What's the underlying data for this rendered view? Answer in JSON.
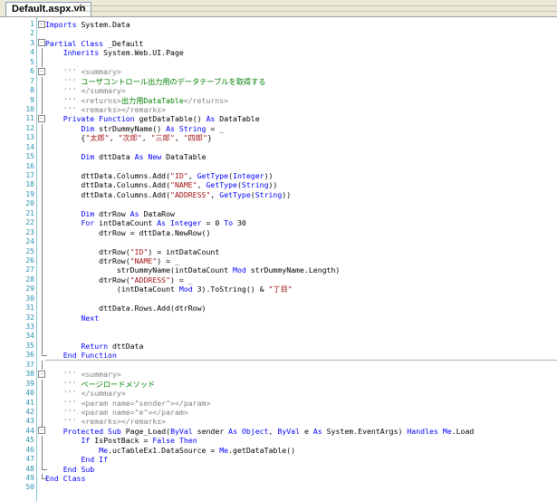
{
  "tab": {
    "title": "Default.aspx.vb"
  },
  "lines": [
    {
      "n": "1",
      "fold": "box-minus",
      "segs": [
        {
          "t": "Imports",
          "c": "k"
        },
        {
          "t": " System.Data",
          "c": ""
        }
      ]
    },
    {
      "n": "2",
      "fold": "",
      "segs": []
    },
    {
      "n": "3",
      "fold": "box-minus",
      "segs": [
        {
          "t": "Partial",
          "c": "k"
        },
        {
          "t": " ",
          "c": ""
        },
        {
          "t": "Class",
          "c": "k"
        },
        {
          "t": " _Default",
          "c": ""
        }
      ]
    },
    {
      "n": "4",
      "fold": "bar",
      "segs": [
        {
          "t": "    ",
          "c": ""
        },
        {
          "t": "Inherits",
          "c": "k"
        },
        {
          "t": " System.Web.UI.Page",
          "c": ""
        }
      ]
    },
    {
      "n": "5",
      "fold": "bar",
      "segs": []
    },
    {
      "n": "6",
      "fold": "box-minus",
      "segs": [
        {
          "t": "    ",
          "c": ""
        },
        {
          "t": "'''",
          "c": "cm"
        },
        {
          "t": " ",
          "c": ""
        },
        {
          "t": "<summary>",
          "c": "cm"
        }
      ]
    },
    {
      "n": "7",
      "fold": "bar",
      "segs": [
        {
          "t": "    ",
          "c": ""
        },
        {
          "t": "'''",
          "c": "cm"
        },
        {
          "t": " ユーザコントロール出力用のデータテーブルを取得する",
          "c": "c"
        }
      ]
    },
    {
      "n": "8",
      "fold": "bar",
      "segs": [
        {
          "t": "    ",
          "c": ""
        },
        {
          "t": "'''",
          "c": "cm"
        },
        {
          "t": " ",
          "c": ""
        },
        {
          "t": "</summary>",
          "c": "cm"
        }
      ]
    },
    {
      "n": "9",
      "fold": "bar",
      "segs": [
        {
          "t": "    ",
          "c": ""
        },
        {
          "t": "'''",
          "c": "cm"
        },
        {
          "t": " ",
          "c": ""
        },
        {
          "t": "<returns>",
          "c": "cm"
        },
        {
          "t": "出力用DataTable",
          "c": "c"
        },
        {
          "t": "</returns>",
          "c": "cm"
        }
      ]
    },
    {
      "n": "10",
      "fold": "bar",
      "segs": [
        {
          "t": "    ",
          "c": ""
        },
        {
          "t": "'''",
          "c": "cm"
        },
        {
          "t": " ",
          "c": ""
        },
        {
          "t": "<remarks></remarks>",
          "c": "cm"
        }
      ]
    },
    {
      "n": "11",
      "fold": "box-minus",
      "segs": [
        {
          "t": "    ",
          "c": ""
        },
        {
          "t": "Private",
          "c": "k"
        },
        {
          "t": " ",
          "c": ""
        },
        {
          "t": "Function",
          "c": "k"
        },
        {
          "t": " getDataTable() ",
          "c": ""
        },
        {
          "t": "As",
          "c": "k"
        },
        {
          "t": " DataTable",
          "c": ""
        }
      ]
    },
    {
      "n": "12",
      "fold": "bar",
      "segs": [
        {
          "t": "        ",
          "c": ""
        },
        {
          "t": "Dim",
          "c": "k"
        },
        {
          "t": " strDummyName() ",
          "c": ""
        },
        {
          "t": "As",
          "c": "k"
        },
        {
          "t": " ",
          "c": ""
        },
        {
          "t": "String",
          "c": "k"
        },
        {
          "t": " = _",
          "c": ""
        }
      ]
    },
    {
      "n": "13",
      "fold": "bar",
      "segs": [
        {
          "t": "        {",
          "c": ""
        },
        {
          "t": "\"太郎\"",
          "c": "s"
        },
        {
          "t": ", ",
          "c": ""
        },
        {
          "t": "\"次郎\"",
          "c": "s"
        },
        {
          "t": ", ",
          "c": ""
        },
        {
          "t": "\"三郎\"",
          "c": "s"
        },
        {
          "t": ", ",
          "c": ""
        },
        {
          "t": "\"四郎\"",
          "c": "s"
        },
        {
          "t": "}",
          "c": ""
        }
      ]
    },
    {
      "n": "14",
      "fold": "bar",
      "segs": []
    },
    {
      "n": "15",
      "fold": "bar",
      "segs": [
        {
          "t": "        ",
          "c": ""
        },
        {
          "t": "Dim",
          "c": "k"
        },
        {
          "t": " dttData ",
          "c": ""
        },
        {
          "t": "As",
          "c": "k"
        },
        {
          "t": " ",
          "c": ""
        },
        {
          "t": "New",
          "c": "k"
        },
        {
          "t": " DataTable",
          "c": ""
        }
      ]
    },
    {
      "n": "16",
      "fold": "bar",
      "segs": []
    },
    {
      "n": "17",
      "fold": "bar",
      "segs": [
        {
          "t": "        dttData.Columns.Add(",
          "c": ""
        },
        {
          "t": "\"ID\"",
          "c": "s"
        },
        {
          "t": ", ",
          "c": ""
        },
        {
          "t": "GetType",
          "c": "k"
        },
        {
          "t": "(",
          "c": ""
        },
        {
          "t": "Integer",
          "c": "k"
        },
        {
          "t": "))",
          "c": ""
        }
      ]
    },
    {
      "n": "18",
      "fold": "bar",
      "segs": [
        {
          "t": "        dttData.Columns.Add(",
          "c": ""
        },
        {
          "t": "\"NAME\"",
          "c": "s"
        },
        {
          "t": ", ",
          "c": ""
        },
        {
          "t": "GetType",
          "c": "k"
        },
        {
          "t": "(",
          "c": ""
        },
        {
          "t": "String",
          "c": "k"
        },
        {
          "t": "))",
          "c": ""
        }
      ]
    },
    {
      "n": "19",
      "fold": "bar",
      "segs": [
        {
          "t": "        dttData.Columns.Add(",
          "c": ""
        },
        {
          "t": "\"ADDRESS\"",
          "c": "s"
        },
        {
          "t": ", ",
          "c": ""
        },
        {
          "t": "GetType",
          "c": "k"
        },
        {
          "t": "(",
          "c": ""
        },
        {
          "t": "String",
          "c": "k"
        },
        {
          "t": "))",
          "c": ""
        }
      ]
    },
    {
      "n": "20",
      "fold": "bar",
      "segs": []
    },
    {
      "n": "21",
      "fold": "bar",
      "segs": [
        {
          "t": "        ",
          "c": ""
        },
        {
          "t": "Dim",
          "c": "k"
        },
        {
          "t": " dtrRow ",
          "c": ""
        },
        {
          "t": "As",
          "c": "k"
        },
        {
          "t": " DataRow",
          "c": ""
        }
      ]
    },
    {
      "n": "22",
      "fold": "bar",
      "segs": [
        {
          "t": "        ",
          "c": ""
        },
        {
          "t": "For",
          "c": "k"
        },
        {
          "t": " intDataCount ",
          "c": ""
        },
        {
          "t": "As",
          "c": "k"
        },
        {
          "t": " ",
          "c": ""
        },
        {
          "t": "Integer",
          "c": "k"
        },
        {
          "t": " = 0 ",
          "c": ""
        },
        {
          "t": "To",
          "c": "k"
        },
        {
          "t": " 30",
          "c": ""
        }
      ]
    },
    {
      "n": "23",
      "fold": "bar",
      "segs": [
        {
          "t": "            dtrRow = dttData.NewRow()",
          "c": ""
        }
      ]
    },
    {
      "n": "24",
      "fold": "bar",
      "segs": []
    },
    {
      "n": "25",
      "fold": "bar",
      "segs": [
        {
          "t": "            dtrRow(",
          "c": ""
        },
        {
          "t": "\"ID\"",
          "c": "s"
        },
        {
          "t": ") = intDataCount",
          "c": ""
        }
      ]
    },
    {
      "n": "26",
      "fold": "bar",
      "segs": [
        {
          "t": "            dtrRow(",
          "c": ""
        },
        {
          "t": "\"NAME\"",
          "c": "s"
        },
        {
          "t": ") = _",
          "c": ""
        }
      ]
    },
    {
      "n": "27",
      "fold": "bar",
      "segs": [
        {
          "t": "                strDummyName(intDataCount ",
          "c": ""
        },
        {
          "t": "Mod",
          "c": "k"
        },
        {
          "t": " strDummyName.Length)",
          "c": ""
        }
      ]
    },
    {
      "n": "28",
      "fold": "bar",
      "segs": [
        {
          "t": "            dtrRow(",
          "c": ""
        },
        {
          "t": "\"ADDRESS\"",
          "c": "s"
        },
        {
          "t": ") = _",
          "c": ""
        }
      ]
    },
    {
      "n": "29",
      "fold": "bar",
      "segs": [
        {
          "t": "                (intDataCount ",
          "c": ""
        },
        {
          "t": "Mod",
          "c": "k"
        },
        {
          "t": " 3).ToString() & ",
          "c": ""
        },
        {
          "t": "\"丁目\"",
          "c": "s"
        }
      ]
    },
    {
      "n": "30",
      "fold": "bar",
      "segs": []
    },
    {
      "n": "31",
      "fold": "bar",
      "segs": [
        {
          "t": "            dttData.Rows.Add(dtrRow)",
          "c": ""
        }
      ]
    },
    {
      "n": "32",
      "fold": "bar",
      "segs": [
        {
          "t": "        ",
          "c": ""
        },
        {
          "t": "Next",
          "c": "k"
        }
      ]
    },
    {
      "n": "33",
      "fold": "bar",
      "segs": []
    },
    {
      "n": "34",
      "fold": "bar",
      "segs": []
    },
    {
      "n": "35",
      "fold": "bar",
      "segs": [
        {
          "t": "        ",
          "c": ""
        },
        {
          "t": "Return",
          "c": "k"
        },
        {
          "t": " dttData",
          "c": ""
        }
      ]
    },
    {
      "n": "36",
      "fold": "end",
      "sep": true,
      "segs": [
        {
          "t": "    ",
          "c": ""
        },
        {
          "t": "End",
          "c": "k"
        },
        {
          "t": " ",
          "c": ""
        },
        {
          "t": "Function",
          "c": "k"
        }
      ]
    },
    {
      "n": "37",
      "fold": "bar",
      "segs": []
    },
    {
      "n": "38",
      "fold": "box-minus",
      "segs": [
        {
          "t": "    ",
          "c": ""
        },
        {
          "t": "'''",
          "c": "cm"
        },
        {
          "t": " ",
          "c": ""
        },
        {
          "t": "<summary>",
          "c": "cm"
        }
      ]
    },
    {
      "n": "39",
      "fold": "bar",
      "segs": [
        {
          "t": "    ",
          "c": ""
        },
        {
          "t": "'''",
          "c": "cm"
        },
        {
          "t": " ページロードメソッド",
          "c": "c"
        }
      ]
    },
    {
      "n": "40",
      "fold": "bar",
      "segs": [
        {
          "t": "    ",
          "c": ""
        },
        {
          "t": "'''",
          "c": "cm"
        },
        {
          "t": " ",
          "c": ""
        },
        {
          "t": "</summary>",
          "c": "cm"
        }
      ]
    },
    {
      "n": "41",
      "fold": "bar",
      "segs": [
        {
          "t": "    ",
          "c": ""
        },
        {
          "t": "'''",
          "c": "cm"
        },
        {
          "t": " ",
          "c": ""
        },
        {
          "t": "<param name=\"sender\"></param>",
          "c": "cm"
        }
      ]
    },
    {
      "n": "42",
      "fold": "bar",
      "segs": [
        {
          "t": "    ",
          "c": ""
        },
        {
          "t": "'''",
          "c": "cm"
        },
        {
          "t": " ",
          "c": ""
        },
        {
          "t": "<param name=\"e\"></param>",
          "c": "cm"
        }
      ]
    },
    {
      "n": "43",
      "fold": "bar",
      "segs": [
        {
          "t": "    ",
          "c": ""
        },
        {
          "t": "'''",
          "c": "cm"
        },
        {
          "t": " ",
          "c": ""
        },
        {
          "t": "<remarks></remarks>",
          "c": "cm"
        }
      ]
    },
    {
      "n": "44",
      "fold": "box-minus",
      "segs": [
        {
          "t": "    ",
          "c": ""
        },
        {
          "t": "Protected",
          "c": "k"
        },
        {
          "t": " ",
          "c": ""
        },
        {
          "t": "Sub",
          "c": "k"
        },
        {
          "t": " Page_Load(",
          "c": ""
        },
        {
          "t": "ByVal",
          "c": "k"
        },
        {
          "t": " sender ",
          "c": ""
        },
        {
          "t": "As",
          "c": "k"
        },
        {
          "t": " ",
          "c": ""
        },
        {
          "t": "Object",
          "c": "k"
        },
        {
          "t": ", ",
          "c": ""
        },
        {
          "t": "ByVal",
          "c": "k"
        },
        {
          "t": " e ",
          "c": ""
        },
        {
          "t": "As",
          "c": "k"
        },
        {
          "t": " System.EventArgs) ",
          "c": ""
        },
        {
          "t": "Handles",
          "c": "k"
        },
        {
          "t": " ",
          "c": ""
        },
        {
          "t": "Me",
          "c": "k"
        },
        {
          "t": ".Load",
          "c": ""
        }
      ]
    },
    {
      "n": "45",
      "fold": "bar",
      "segs": [
        {
          "t": "        ",
          "c": ""
        },
        {
          "t": "If",
          "c": "k"
        },
        {
          "t": " IsPostBack = ",
          "c": ""
        },
        {
          "t": "False",
          "c": "k"
        },
        {
          "t": " ",
          "c": ""
        },
        {
          "t": "Then",
          "c": "k"
        }
      ]
    },
    {
      "n": "46",
      "fold": "bar",
      "segs": [
        {
          "t": "            ",
          "c": ""
        },
        {
          "t": "Me",
          "c": "k"
        },
        {
          "t": ".ucTableEx1.DataSource = ",
          "c": ""
        },
        {
          "t": "Me",
          "c": "k"
        },
        {
          "t": ".getDataTable()",
          "c": ""
        }
      ]
    },
    {
      "n": "47",
      "fold": "bar",
      "segs": [
        {
          "t": "        ",
          "c": ""
        },
        {
          "t": "End",
          "c": "k"
        },
        {
          "t": " ",
          "c": ""
        },
        {
          "t": "If",
          "c": "k"
        }
      ]
    },
    {
      "n": "48",
      "fold": "end",
      "segs": [
        {
          "t": "    ",
          "c": ""
        },
        {
          "t": "End",
          "c": "k"
        },
        {
          "t": " ",
          "c": ""
        },
        {
          "t": "Sub",
          "c": "k"
        }
      ]
    },
    {
      "n": "49",
      "fold": "end",
      "segs": [
        {
          "t": "End",
          "c": "k"
        },
        {
          "t": " ",
          "c": ""
        },
        {
          "t": "Class",
          "c": "k"
        }
      ]
    },
    {
      "n": "50",
      "fold": "",
      "segs": []
    }
  ]
}
